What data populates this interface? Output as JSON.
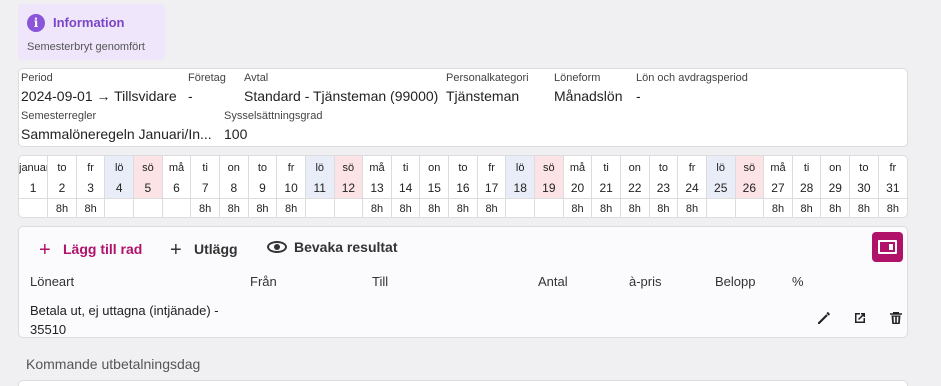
{
  "info": {
    "title": "Information",
    "message": "Semesterbryt genomfört",
    "icon": "info-icon",
    "accent": "#8a55d8"
  },
  "details": {
    "period_label": "Period",
    "period_value": "2024-09-01 → Tillsvidare",
    "company_label": "Företag",
    "company_value": "-",
    "agreement_label": "Avtal",
    "agreement_value": "Standard - Tjänsteman (99000)",
    "category_label": "Personalkategori",
    "category_value": "Tjänsteman",
    "salary_form_label": "Löneform",
    "salary_form_value": "Månadslön",
    "salary_period_label": "Lön och avdragsperiod",
    "salary_period_value": "-",
    "vacation_rules_label": "Semesterregler",
    "vacation_rules_value": "Sammalöneregeln Januari/In...",
    "employment_rate_label": "Sysselsättningsgrad",
    "employment_rate_value": "100"
  },
  "calendar": {
    "days": [
      {
        "name": "januari",
        "date": "1",
        "hours": "",
        "type": ""
      },
      {
        "name": "to",
        "date": "2",
        "hours": "8h",
        "type": ""
      },
      {
        "name": "fr",
        "date": "3",
        "hours": "8h",
        "type": ""
      },
      {
        "name": "lö",
        "date": "4",
        "hours": "",
        "type": "sat"
      },
      {
        "name": "sö",
        "date": "5",
        "hours": "",
        "type": "sun"
      },
      {
        "name": "må",
        "date": "6",
        "hours": "",
        "type": ""
      },
      {
        "name": "ti",
        "date": "7",
        "hours": "8h",
        "type": ""
      },
      {
        "name": "on",
        "date": "8",
        "hours": "8h",
        "type": ""
      },
      {
        "name": "to",
        "date": "9",
        "hours": "8h",
        "type": ""
      },
      {
        "name": "fr",
        "date": "10",
        "hours": "8h",
        "type": ""
      },
      {
        "name": "lö",
        "date": "11",
        "hours": "",
        "type": "sat"
      },
      {
        "name": "sö",
        "date": "12",
        "hours": "",
        "type": "sun"
      },
      {
        "name": "må",
        "date": "13",
        "hours": "8h",
        "type": ""
      },
      {
        "name": "ti",
        "date": "14",
        "hours": "8h",
        "type": ""
      },
      {
        "name": "on",
        "date": "15",
        "hours": "8h",
        "type": ""
      },
      {
        "name": "to",
        "date": "16",
        "hours": "8h",
        "type": ""
      },
      {
        "name": "fr",
        "date": "17",
        "hours": "8h",
        "type": ""
      },
      {
        "name": "lö",
        "date": "18",
        "hours": "",
        "type": "sat"
      },
      {
        "name": "sö",
        "date": "19",
        "hours": "",
        "type": "sun"
      },
      {
        "name": "må",
        "date": "20",
        "hours": "8h",
        "type": ""
      },
      {
        "name": "ti",
        "date": "21",
        "hours": "8h",
        "type": ""
      },
      {
        "name": "on",
        "date": "22",
        "hours": "8h",
        "type": ""
      },
      {
        "name": "to",
        "date": "23",
        "hours": "8h",
        "type": ""
      },
      {
        "name": "fr",
        "date": "24",
        "hours": "8h",
        "type": ""
      },
      {
        "name": "lö",
        "date": "25",
        "hours": "",
        "type": "sat"
      },
      {
        "name": "sö",
        "date": "26",
        "hours": "",
        "type": "sun"
      },
      {
        "name": "må",
        "date": "27",
        "hours": "8h",
        "type": ""
      },
      {
        "name": "ti",
        "date": "28",
        "hours": "8h",
        "type": ""
      },
      {
        "name": "on",
        "date": "29",
        "hours": "8h",
        "type": ""
      },
      {
        "name": "to",
        "date": "30",
        "hours": "8h",
        "type": ""
      },
      {
        "name": "fr",
        "date": "31",
        "hours": "8h",
        "type": ""
      }
    ]
  },
  "toolbar": {
    "add_row_label": "Lägg till rad",
    "expense_label": "Utlägg",
    "watch_result_label": "Bevaka resultat",
    "accent": "#b0126a"
  },
  "columns": {
    "wage_type": "Löneart",
    "from": "Från",
    "to": "Till",
    "quantity": "Antal",
    "unit_price": "à-pris",
    "amount": "Belopp",
    "percent": "%"
  },
  "row": {
    "line1": "Betala ut, ej uttagna (intjänade) -",
    "line2": "35510"
  },
  "upcoming_label": "Kommande utbetalningsdag"
}
